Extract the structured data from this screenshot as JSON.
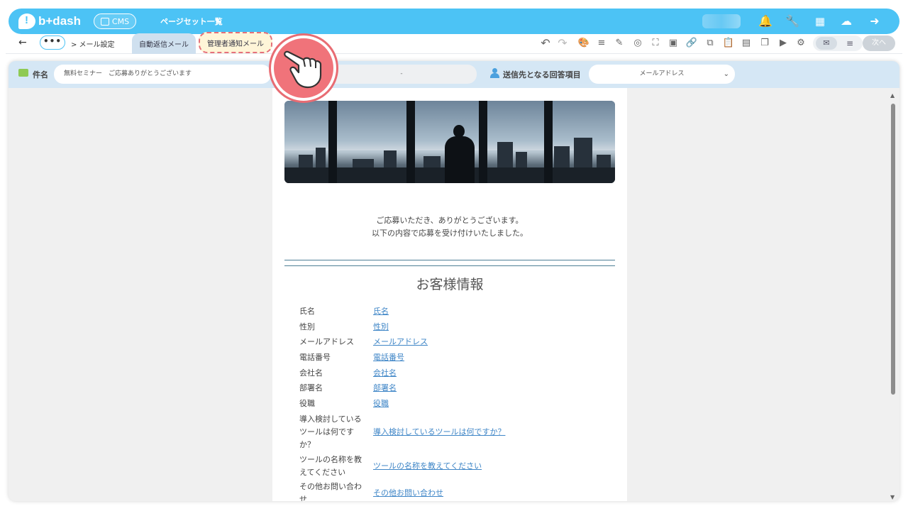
{
  "topbar": {
    "logo": "b+dash",
    "cms_label": "CMS",
    "page_set_label": "ページセット一覧",
    "icons": [
      "bell-icon",
      "wrench-icon",
      "grid-icon",
      "support-icon",
      "logout-icon"
    ]
  },
  "subbar": {
    "more_label": "•••",
    "breadcrumb": "> メール設定",
    "tabs": [
      {
        "label": "自動返信メール"
      },
      {
        "label": "管理者通知メール"
      }
    ],
    "next_label": "次へ"
  },
  "editor": {
    "subject_label": "件名",
    "subject_value": "無料セミナー　ご応募ありがとうございます",
    "subject_secondary": "-",
    "recipient_label": "送信先となる回答項目",
    "recipient_value": "メールアドレス"
  },
  "email": {
    "greeting_line1": "ご応募いただき、ありがとうございます。",
    "greeting_line2": "以下の内容で応募を受け付けいたしました。",
    "section_title": "お客様情報",
    "fields": [
      {
        "label": "氏名",
        "value": "氏名"
      },
      {
        "label": "性別",
        "value": "性別"
      },
      {
        "label": "メールアドレス",
        "value": "メールアドレス"
      },
      {
        "label": "電話番号",
        "value": "電話番号"
      },
      {
        "label": "会社名",
        "value": "会社名"
      },
      {
        "label": "部署名",
        "value": "部署名"
      },
      {
        "label": "役職",
        "value": "役職"
      },
      {
        "label": "導入検討しているツールは何ですか？",
        "value": "導入検討しているツールは何ですか？"
      },
      {
        "label": "ツールの名称を教えてください",
        "value": "ツールの名称を教えてください"
      },
      {
        "label": "その他お問い合わせ",
        "value": "その他お問い合わせ"
      }
    ]
  }
}
